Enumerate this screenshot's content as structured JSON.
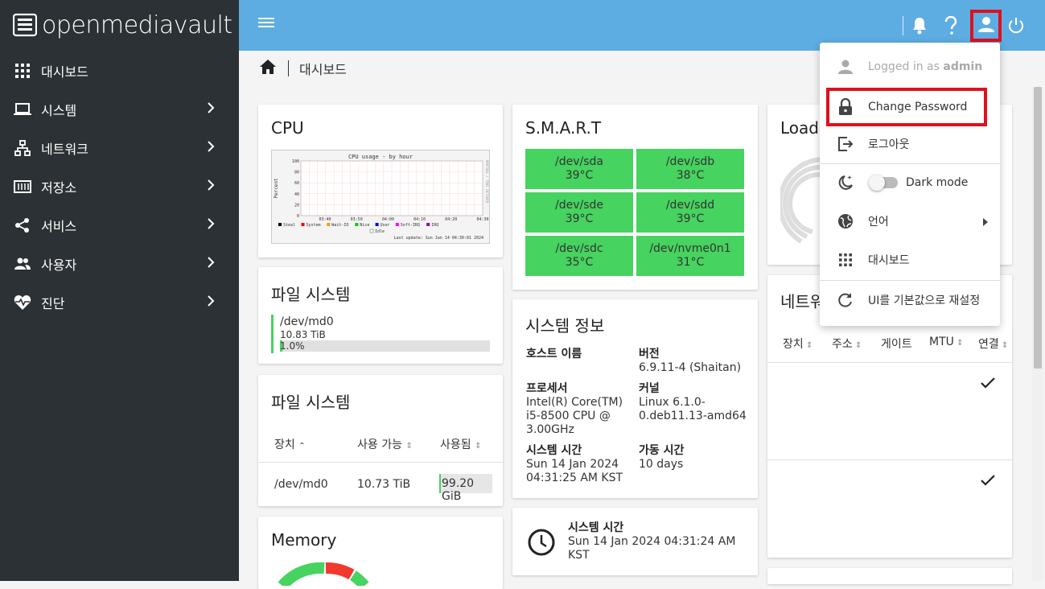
{
  "app": {
    "logo_text": "openmediavault"
  },
  "sidebar": {
    "items": [
      {
        "label": "대시보드",
        "icon": "grid-icon"
      },
      {
        "label": "시스템",
        "icon": "laptop-icon"
      },
      {
        "label": "네트워크",
        "icon": "network-icon"
      },
      {
        "label": "저장소",
        "icon": "storage-icon"
      },
      {
        "label": "서비스",
        "icon": "share-icon"
      },
      {
        "label": "사용자",
        "icon": "users-icon"
      },
      {
        "label": "진단",
        "icon": "heartbeat-icon"
      }
    ]
  },
  "breadcrumb": {
    "current": "대시보드"
  },
  "cpu": {
    "title": "CPU",
    "graph_title": "CPU usage - by hour",
    "ylabel": "Percent",
    "side_label": "RRDTOOL / TOBI OETIKER",
    "yticks": [
      "100",
      "80",
      "60",
      "40",
      "20",
      "0"
    ],
    "xticks": [
      "03:40",
      "03:50",
      "04:00",
      "04:10",
      "04:20",
      "04:30"
    ],
    "legend": [
      "Steal",
      "System",
      "Wait-IO",
      "Nice",
      "User",
      "Soft-IRQ",
      "IRQ",
      "Idle"
    ],
    "legend_colors": [
      "#000000",
      "#ff0000",
      "#ff9900",
      "#00cc00",
      "#0000ff",
      "#ff00ff",
      "#990099",
      "#ffffff"
    ],
    "last_update": "Last update: Sun Jan 14 04:30:01 2024"
  },
  "fs1": {
    "title": "파일 시스템",
    "device": "/dev/md0",
    "size": "10.83 TiB",
    "percent": "1.0%",
    "percent_value": 1.0
  },
  "fs2": {
    "title": "파일 시스템",
    "headers": [
      "장치",
      "사용 가능",
      "사용됨"
    ],
    "row": {
      "device": "/dev/md0",
      "available": "10.73 TiB",
      "used": "99.20 GiB"
    }
  },
  "memory": {
    "title": "Memory"
  },
  "smart": {
    "title": "S.M.A.R.T",
    "disks": [
      {
        "name": "/dev/sda",
        "temp": "39°C"
      },
      {
        "name": "/dev/sdb",
        "temp": "38°C"
      },
      {
        "name": "/dev/sde",
        "temp": "39°C"
      },
      {
        "name": "/dev/sdd",
        "temp": "39°C"
      },
      {
        "name": "/dev/sdc",
        "temp": "35°C"
      },
      {
        "name": "/dev/nvme0n1",
        "temp": "31°C"
      }
    ]
  },
  "sysinfo": {
    "title": "시스템 정보",
    "hostname_label": "호스트 이름",
    "version_label": "버전",
    "version": "6.9.11-4 (Shaitan)",
    "processor_label": "프로세서",
    "processor_lines": [
      "Intel(R) Core(TM)",
      "i5-8500 CPU @",
      "3.00GHz"
    ],
    "kernel_label": "커널",
    "kernel_lines": [
      "Linux 6.1.0-",
      "0.deb11.13-amd64"
    ],
    "systime_label": "시스템 시간",
    "systime_lines": [
      "Sun 14 Jan 2024",
      "04:31:25 AM KST"
    ],
    "uptime_label": "가동 시간",
    "uptime": "10 days"
  },
  "clock": {
    "label": "시스템 시간",
    "lines": [
      "Sun 14 Jan 2024 04:31:24 AM",
      "KST"
    ]
  },
  "load": {
    "title": "Load"
  },
  "network": {
    "title": "네트워",
    "headers": [
      "장치",
      "주소",
      "게이트",
      "MTU",
      "연결"
    ]
  },
  "user_menu": {
    "logged_in_prefix": "Logged in as ",
    "username": "admin",
    "change_password": "Change Password",
    "logout": "로그아웃",
    "dark_mode": "Dark mode",
    "language": "언어",
    "dashboard": "대시보드",
    "reset_ui": "UI를 기본값으로 재설정"
  },
  "colors": {
    "sidebar": "#2b3134",
    "topbar": "#5dade2",
    "smart_ok": "#46d35f",
    "highlight": "#e0101e"
  }
}
